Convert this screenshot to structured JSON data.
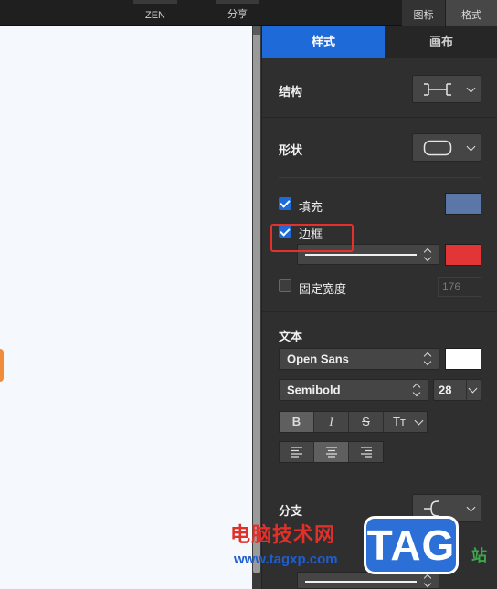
{
  "toolbar": {
    "zen_label": "ZEN",
    "share_label": "分享",
    "icon_label": "图标",
    "format_label": "格式"
  },
  "panel": {
    "tabs": [
      {
        "label": "样式",
        "active": true
      },
      {
        "label": "画布",
        "active": false
      }
    ],
    "structure": {
      "label": "结构",
      "icon": "structure-brackets-icon"
    },
    "shape": {
      "label": "形状",
      "icon": "rounded-rect-icon"
    },
    "fill": {
      "label": "填充",
      "checked": true,
      "color": "#5a77a8"
    },
    "border": {
      "label": "边框",
      "checked": true,
      "color": "#e23535"
    },
    "fixed_width": {
      "label": "固定宽度",
      "checked": false,
      "value": "176"
    },
    "text": {
      "label": "文本",
      "font_family": "Open Sans",
      "font_color": "#ffffff",
      "font_weight": "Semibold",
      "font_size": "28",
      "style_buttons": [
        "B",
        "I",
        "S",
        "Tт"
      ],
      "align_buttons": [
        "align-left-icon",
        "align-center-icon",
        "align-right-icon"
      ]
    },
    "branch": {
      "label": "分支",
      "icon": "branch-curve-icon"
    }
  },
  "watermark": {
    "site_name": "电脑技术网",
    "site_url": "www.tagxp.com",
    "badge": "TAG",
    "partial": "站"
  },
  "colors": {
    "accent": "#1e6ad8",
    "highlight": "#e4312b",
    "canvas_bg": "#f5f8fd",
    "node": "#f08c3a"
  }
}
